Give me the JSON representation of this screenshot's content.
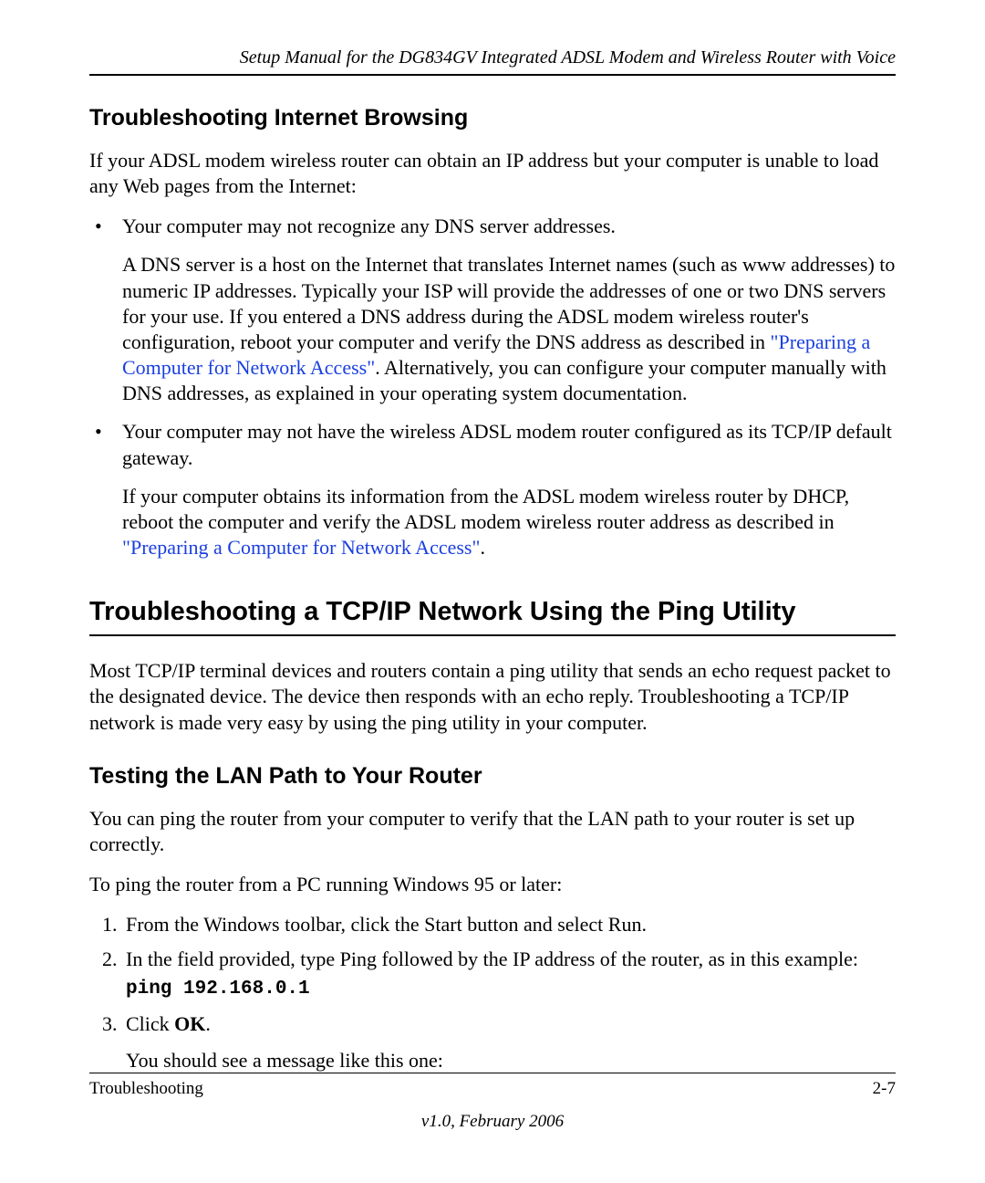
{
  "header": {
    "title": "Setup Manual for the DG834GV Integrated ADSL Modem and Wireless Router with Voice"
  },
  "section1": {
    "heading": "Troubleshooting Internet Browsing",
    "intro": "If your ADSL modem wireless router can obtain an IP address but your computer is unable to load any Web pages from the Internet:",
    "bullet1": {
      "text": "Your computer may not recognize any DNS server addresses.",
      "detail_before_link": "A DNS server is a host on the Internet that translates Internet names (such as www addresses) to numeric IP addresses. Typically your ISP will provide the addresses of one or two DNS servers for your use. If you entered a DNS address during the ADSL modem wireless router's configuration, reboot your computer and verify the DNS address as described in ",
      "link": "\"Preparing a Computer for Network Access\"",
      "detail_after_link": ". Alternatively, you can configure your computer manually with DNS addresses, as explained in your operating system documentation."
    },
    "bullet2": {
      "text": "Your computer may not have the wireless ADSL modem router configured as its TCP/IP default gateway.",
      "detail_before_link": "If your computer obtains its information from the ADSL modem wireless router by DHCP, reboot the computer and verify the ADSL modem wireless router address as described in ",
      "link": "\"Preparing a Computer for Network Access\"",
      "detail_after_link": "."
    }
  },
  "section2": {
    "heading": "Troubleshooting a TCP/IP Network Using the Ping Utility",
    "intro": "Most TCP/IP terminal devices and routers contain a ping utility that sends an echo request packet to the designated device. The device then responds with an echo reply. Troubleshooting a TCP/IP network is made very easy by using the ping utility in your computer."
  },
  "section3": {
    "heading": "Testing the LAN Path to Your Router",
    "p1": "You can ping the router from your computer to verify that the LAN path to your router is set up correctly.",
    "p2": "To ping the router from a PC running Windows 95 or later:",
    "step1": "From the Windows toolbar, click the Start button and select Run.",
    "step2": "In the field provided, type Ping followed by the IP address of the router, as in this example:",
    "code": "ping 192.168.0.1",
    "step3_pre": "Click ",
    "step3_bold": "OK",
    "step3_post": ".",
    "step3_detail": "You should see a message like this one:"
  },
  "footer": {
    "left": "Troubleshooting",
    "right": "2-7",
    "version": "v1.0, February 2006"
  }
}
